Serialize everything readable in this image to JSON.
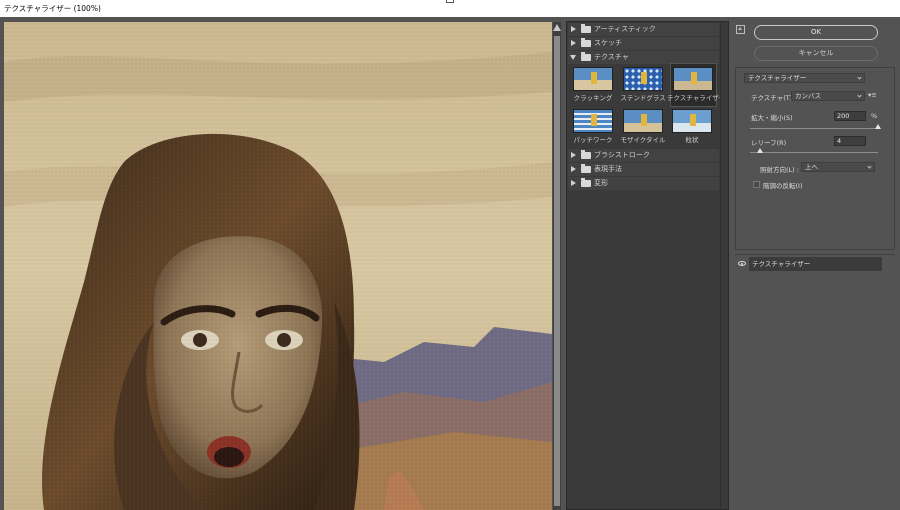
{
  "window": {
    "title": "テクスチャライザー (100%)"
  },
  "gallery": {
    "categories": [
      {
        "label": "アーティスティック",
        "expanded": false
      },
      {
        "label": "スケッチ",
        "expanded": false
      },
      {
        "label": "テクスチャ",
        "expanded": true
      },
      {
        "label": "ブラシストローク",
        "expanded": false
      },
      {
        "label": "表現手法",
        "expanded": false
      },
      {
        "label": "変形",
        "expanded": false
      }
    ],
    "thumbnails": [
      {
        "label": "クラッキング",
        "selected": false
      },
      {
        "label": "ステンドグラス",
        "selected": false
      },
      {
        "label": "テクスチャライザー",
        "selected": true
      },
      {
        "label": "パッチワーク",
        "selected": false
      },
      {
        "label": "モザイクタイル",
        "selected": false
      },
      {
        "label": "粒状",
        "selected": false
      }
    ]
  },
  "buttons": {
    "ok": "OK",
    "cancel": "キャンセル"
  },
  "settings": {
    "filter_select": "テクスチャライザー",
    "texture_label": "テクスチャ(T) :",
    "texture_value": "カンバス",
    "scaling_label": "拡大・縮小(S)",
    "scaling_value": "200",
    "scaling_unit": "%",
    "scaling_percent_of_range": 100,
    "relief_label": "レリーフ(R)",
    "relief_value": "4",
    "relief_percent_of_range": 8,
    "light_label": "照射方向(L) :",
    "light_value": "上へ",
    "invert_label": "階調の反転(I)",
    "invert_checked": false
  },
  "layers": {
    "items": [
      {
        "label": "テクスチャライザー",
        "visible": true
      }
    ]
  },
  "colors": {
    "panel": "#535353",
    "dark_panel": "#3a3a3a"
  }
}
